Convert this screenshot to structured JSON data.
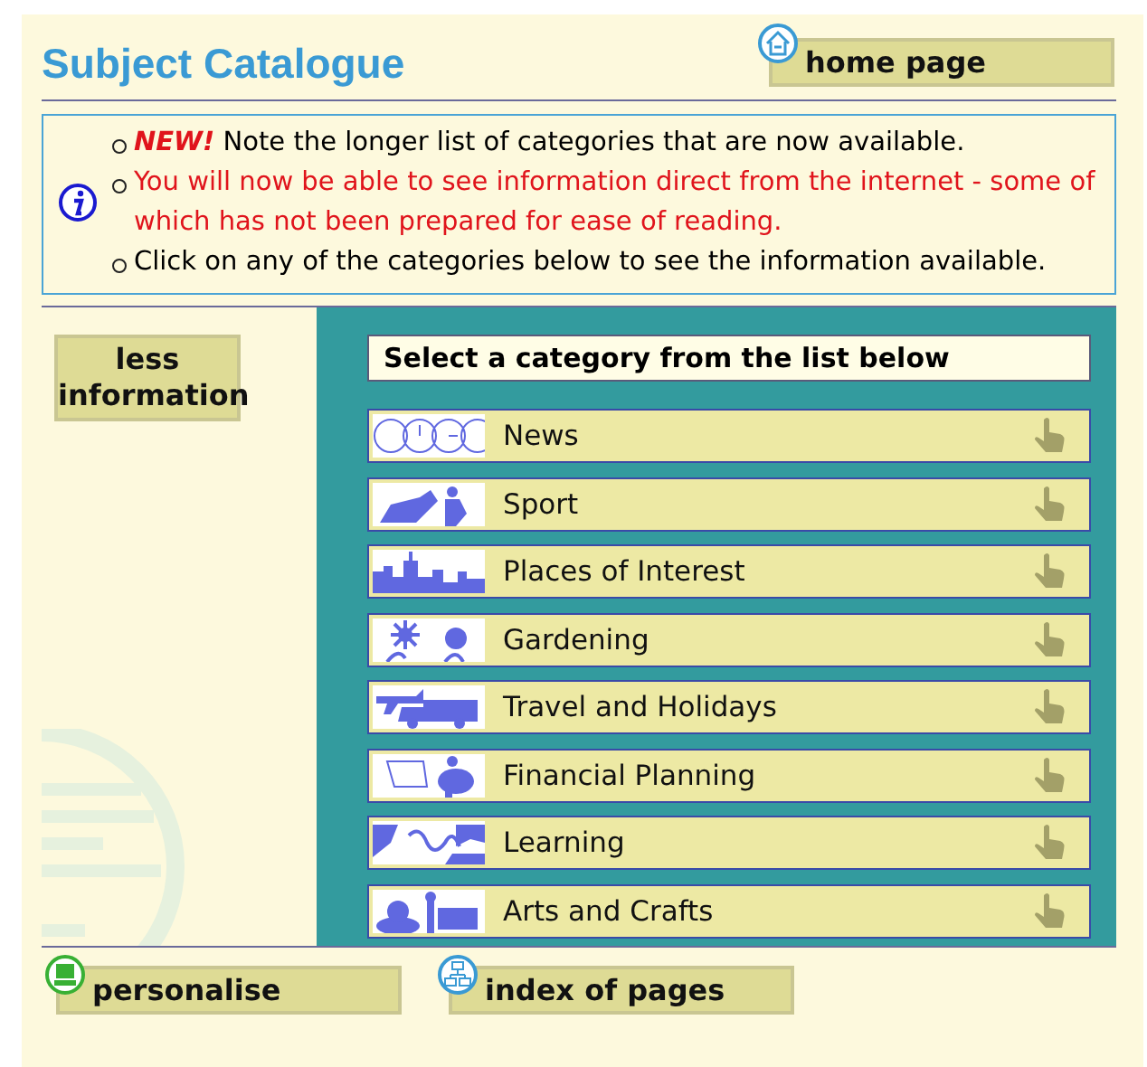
{
  "header": {
    "title": "Subject Catalogue",
    "home_button": "home page"
  },
  "notice": {
    "items": [
      {
        "kind": "normal",
        "text": "**NEW!** Note the longer list of categories that are now available."
      },
      {
        "kind": "warning",
        "text": "You will now be able to see information direct from the internet - some of which has not been prepared for ease of reading."
      },
      {
        "kind": "normal",
        "text": "Click on any of the categories below to see the information available."
      }
    ]
  },
  "side_button": "less information",
  "categories": {
    "heading": "Select a category from the list below",
    "items": [
      "News",
      "Sport",
      "Places of Interest",
      "Gardening",
      "Travel and Holidays",
      "Financial Planning",
      "Learning",
      "Arts and Crafts"
    ]
  },
  "footer": {
    "buttons": [
      "personalise",
      "index of pages"
    ]
  }
}
